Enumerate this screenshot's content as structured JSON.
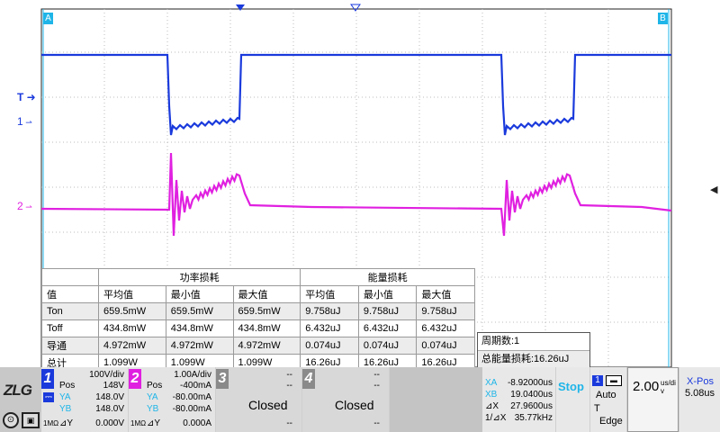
{
  "scope": {
    "cursor_a": "A",
    "cursor_b": "B",
    "trigger_marker": "T",
    "channel1_marker": "1",
    "channel2_marker": "2",
    "colors": {
      "ch1": "#1a3adc",
      "ch2": "#e020e0",
      "grid": "#bcbcbc",
      "cursor": "#1fb5e8"
    }
  },
  "measurements": {
    "group_power": "功率损耗",
    "group_energy": "能量损耗",
    "columns": [
      "值",
      "平均值",
      "最小值",
      "最大值",
      "平均值",
      "最小值",
      "最大值"
    ],
    "rows": [
      [
        "Ton",
        "659.5mW",
        "659.5mW",
        "659.5mW",
        "9.758uJ",
        "9.758uJ",
        "9.758uJ"
      ],
      [
        "Toff",
        "434.8mW",
        "434.8mW",
        "434.8mW",
        "6.432uJ",
        "6.432uJ",
        "6.432uJ"
      ],
      [
        "导通",
        "4.972mW",
        "4.972mW",
        "4.972mW",
        "0.074uJ",
        "0.074uJ",
        "0.074uJ"
      ],
      [
        "总计",
        "1.099W",
        "1.099W",
        "1.099W",
        "16.26uJ",
        "16.26uJ",
        "16.26uJ"
      ]
    ]
  },
  "period": {
    "count": "周期数:1",
    "total": "总能量损耗:16.26uJ"
  },
  "ch1": {
    "num": "1",
    "scale": "100V/div",
    "pos_label": "Pos",
    "pos": "148V",
    "ya_label": "YA",
    "ya": "148.0V",
    "yb_label": "YB",
    "yb": "148.0V",
    "dy_label": "⊿Y",
    "dy": "0.000V",
    "impedance": "1MΩ"
  },
  "ch2": {
    "num": "2",
    "scale": "1.00A/div",
    "pos_label": "Pos",
    "pos": "-400mA",
    "ya_label": "YA",
    "ya": "-80.00mA",
    "yb_label": "YB",
    "yb": "-80.00mA",
    "dy_label": "⊿Y",
    "dy": "0.000A",
    "impedance": "1MΩ"
  },
  "ch3": {
    "num": "3",
    "status": "Closed",
    "dash": "--"
  },
  "ch4": {
    "num": "4",
    "status": "Closed",
    "dash": "--"
  },
  "cursors": {
    "xa_label": "XA",
    "xa": "-8.92000us",
    "xb_label": "XB",
    "xb": "19.0400us",
    "dx_label": "⊿X",
    "dx": "27.9600us",
    "freq_label": "1/⊿X",
    "freq": "35.77kHz"
  },
  "run": {
    "state": "Stop"
  },
  "trigger": {
    "channel": "1",
    "mode": "Auto",
    "type_label": "T",
    "type": "Edge"
  },
  "timebase": {
    "value": "2.00",
    "unit": "us/div"
  },
  "xpos": {
    "label": "X-Pos",
    "value": "5.08us"
  },
  "logo": "ZLG"
}
